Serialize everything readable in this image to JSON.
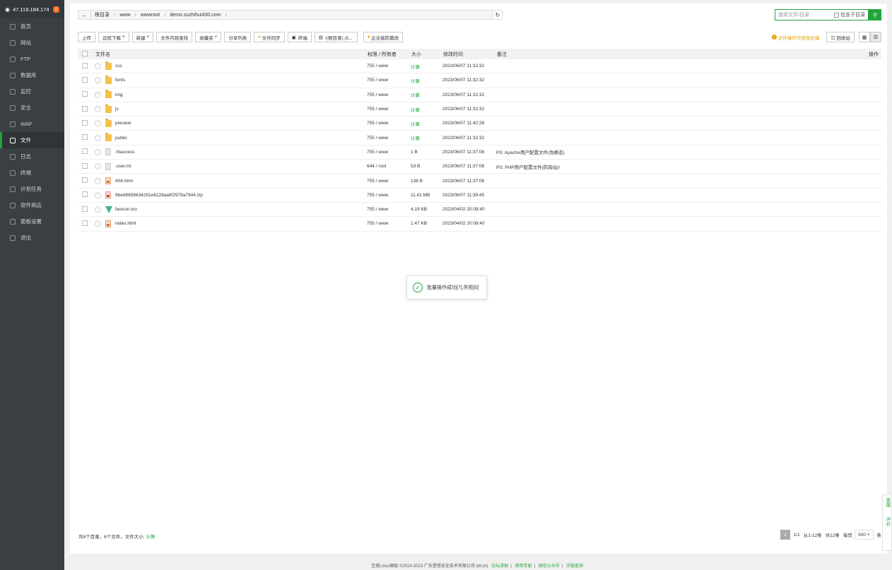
{
  "sidebar": {
    "ip": "47.119.184.174",
    "badge": "0",
    "items": [
      {
        "label": "首页",
        "icon": "home-icon"
      },
      {
        "label": "网站",
        "icon": "globe-icon"
      },
      {
        "label": "FTP",
        "icon": "ftp-icon"
      },
      {
        "label": "数据库",
        "icon": "database-icon"
      },
      {
        "label": "监控",
        "icon": "monitor-icon"
      },
      {
        "label": "安全",
        "icon": "shield-icon"
      },
      {
        "label": "WAF",
        "icon": "waf-icon"
      },
      {
        "label": "文件",
        "icon": "folder-icon"
      },
      {
        "label": "日志",
        "icon": "log-icon"
      },
      {
        "label": "终端",
        "icon": "terminal-icon"
      },
      {
        "label": "计划任务",
        "icon": "clock-icon"
      },
      {
        "label": "软件商店",
        "icon": "store-icon"
      },
      {
        "label": "面板设置",
        "icon": "gear-icon"
      },
      {
        "label": "退出",
        "icon": "logout-icon"
      }
    ],
    "active_index": 7
  },
  "path": {
    "crumbs": [
      "根目录",
      "www",
      "wwwroot",
      "demo.suzhihui430.com"
    ]
  },
  "search": {
    "placeholder": "搜索文件/目录",
    "subdir_label": "包含子目录"
  },
  "toolbar": {
    "upload": "上传",
    "remote_download": "远程下载",
    "new": "新建",
    "content_search": "文件内容查找",
    "favorites": "收藏夹",
    "share_list": "分享列表",
    "file_sync": "文件同步",
    "terminal": "终端",
    "disk": "/(根目录) (5...",
    "tamper": "企业级防篡改"
  },
  "right_tools": {
    "hint": "文件操作可使用右键",
    "recycle": "回收站"
  },
  "table": {
    "headers": {
      "name": "文件名",
      "perm": "权限 / 所有者",
      "size": "大小",
      "time": "修改时间",
      "note": "备注",
      "op": "操作"
    },
    "rows": [
      {
        "name": "css",
        "type": "folder",
        "perm": "755 / www",
        "size": "计算",
        "time": "2023/06/07 11:32:32",
        "note": ""
      },
      {
        "name": "fonts",
        "type": "folder",
        "perm": "755 / www",
        "size": "计算",
        "time": "2023/06/07 11:32:32",
        "note": ""
      },
      {
        "name": "img",
        "type": "folder",
        "perm": "755 / www",
        "size": "计算",
        "time": "2023/06/07 11:32:32",
        "note": ""
      },
      {
        "name": "js",
        "type": "folder",
        "perm": "755 / www",
        "size": "计算",
        "time": "2023/06/07 11:32:32",
        "note": ""
      },
      {
        "name": "preview",
        "type": "folder",
        "perm": "755 / www",
        "size": "计算",
        "time": "2023/06/07 11:42:28",
        "note": ""
      },
      {
        "name": "public",
        "type": "folder",
        "perm": "755 / www",
        "size": "计算",
        "time": "2023/06/07 11:32:32",
        "note": ""
      },
      {
        "name": ".htaccess",
        "type": "file",
        "perm": "755 / www",
        "size": "1 B",
        "time": "2023/06/07 11:37:08",
        "note": "PS: Apache用户配置文件(伪静态)"
      },
      {
        "name": ".user.ini",
        "type": "file",
        "perm": "644 / root",
        "size": "53 B",
        "time": "2023/06/07 11:37:08",
        "note": "PS: PHP用户配置文件(防跨站)!"
      },
      {
        "name": "404.html",
        "type": "html",
        "perm": "755 / www",
        "size": "138 B",
        "time": "2023/06/07 11:37:08",
        "note": ""
      },
      {
        "name": "9bed9658634281e6128aa6f2979a7944.zip",
        "type": "zip",
        "perm": "755 / www",
        "size": "11.41 MB",
        "time": "2023/06/07 11:39:45",
        "note": ""
      },
      {
        "name": "favicon.ico",
        "type": "vue",
        "perm": "755 / www",
        "size": "4.19 KB",
        "time": "2023/04/02 20:08:40",
        "note": ""
      },
      {
        "name": "index.html",
        "type": "html",
        "perm": "755 / www",
        "size": "1.47 KB",
        "time": "2023/04/02 20:08:40",
        "note": ""
      }
    ]
  },
  "summary": {
    "text": "共6个目录，6个文件，文件大小:",
    "calc": "计算"
  },
  "pager": {
    "current": "1",
    "pages": "1/1",
    "range": "从1-12条",
    "total": "共12条",
    "per_page_label": "每页",
    "per_page_value": "500",
    "unit": "条"
  },
  "toast": {
    "message": "批量操作成功[7],失败[0]"
  },
  "side_tab": {
    "service": "客服",
    "review": "评价"
  },
  "copyright": {
    "text": "宝塔Linux面板 ©2014-2023 广东堡塔安全技术有限公司 (bt.cn)",
    "links": [
      "论坛求助",
      "使用手册",
      "微信公众号",
      "正版查询"
    ]
  },
  "colors": {
    "accent": "#20a53a",
    "warning": "#e8a300",
    "sidebar_bg": "#3a3f44"
  }
}
